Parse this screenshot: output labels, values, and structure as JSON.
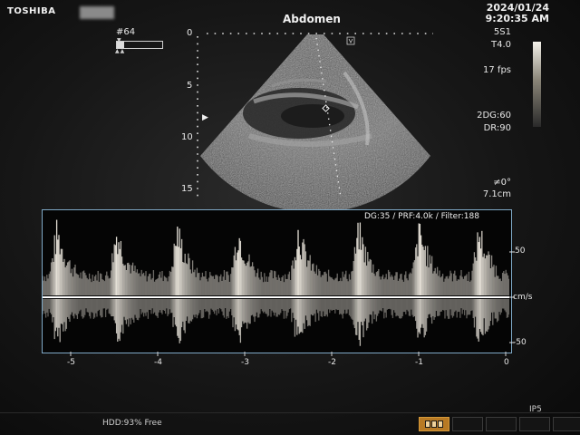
{
  "header": {
    "brand": "TOSHIBA",
    "exam": "Abdomen",
    "date": "2024/01/24",
    "time": "9:20:35 AM"
  },
  "cine": {
    "frame": "#64",
    "marks": "▲▲",
    "position": "▼",
    "progress": 0.15
  },
  "imaging": {
    "probe": "5S1",
    "thermal_index": "T4.0",
    "frame_rate": "17 fps",
    "gain": "2DG:60",
    "dynamic_range": "DR:90",
    "angle": "≠0°",
    "depth": "7.1cm",
    "depth_ticks": [
      "0",
      "5",
      "10",
      "15"
    ],
    "focus_marker": "▶",
    "sample_gate_icon": "sample-gate-icon"
  },
  "doppler": {
    "header": "DG:35 /  PRF:4.0k / Filter:188",
    "velocity_ticks": [
      "50",
      "cm/s",
      "-50"
    ],
    "time_ticks": [
      "-5",
      "-4",
      "-3",
      "-2",
      "-1",
      "0"
    ],
    "colors": {
      "border": "#7fa9c7",
      "baseline": "#ffffff",
      "spectrum": "#f5f0e6"
    }
  },
  "status": {
    "hdd": "HDD:93% Free",
    "ip": "IP5",
    "active_button_icon": "tape-icon"
  }
}
